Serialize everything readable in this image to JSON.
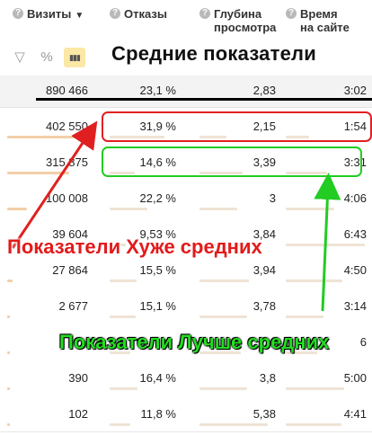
{
  "columns": {
    "visits": "Визиты",
    "visits_sort": "▼",
    "bounces": "Отказы",
    "depth_l1": "Глубина",
    "depth_l2": "просмотра",
    "time_l1": "Время",
    "time_l2": "на сайте"
  },
  "header_icon": "?",
  "tools": {
    "filter_icon": "▽",
    "percent_icon": "%",
    "chart_icon": "▮▮▮"
  },
  "annotations": {
    "average_title": "Средние показатели",
    "worse_label": "Показатели Хуже средних",
    "better_label": "Показатели Лучше средних"
  },
  "totals": {
    "visits": "890 466",
    "bounces": "23,1 %",
    "depth": "2,83",
    "time": "3:02"
  },
  "rows": [
    {
      "visits": "402 550",
      "bounces": "31,9 %",
      "depth": "2,15",
      "time": "1:54",
      "v_frac": 1.0,
      "b_frac": 0.78,
      "d_frac": 0.36,
      "t_frac": 0.3
    },
    {
      "visits": "315 875",
      "bounces": "14,6 %",
      "depth": "3,39",
      "time": "3:31",
      "v_frac": 0.78,
      "b_frac": 0.36,
      "d_frac": 0.57,
      "t_frac": 0.52
    },
    {
      "visits": "100 008",
      "bounces": "22,2 %",
      "depth": "3",
      "time": "4:06",
      "v_frac": 0.25,
      "b_frac": 0.54,
      "d_frac": 0.5,
      "t_frac": 0.61
    },
    {
      "visits": "39 604",
      "bounces": "9,53 %",
      "depth": "3,84",
      "time": "6:43",
      "v_frac": 0.1,
      "b_frac": 0.23,
      "d_frac": 0.64,
      "t_frac": 1.0
    },
    {
      "visits": "27 864",
      "bounces": "15,5 %",
      "depth": "3,94",
      "time": "4:50",
      "v_frac": 0.07,
      "b_frac": 0.38,
      "d_frac": 0.66,
      "t_frac": 0.72
    },
    {
      "visits": "2 677",
      "bounces": "15,1 %",
      "depth": "3,78",
      "time": "3:14",
      "v_frac": 0.01,
      "b_frac": 0.37,
      "d_frac": 0.63,
      "t_frac": 0.48
    },
    {
      "visits": "",
      "bounces": "",
      "depth": "",
      "time": "6",
      "v_frac": 0.01,
      "b_frac": 0.3,
      "d_frac": 0.55,
      "t_frac": 0.4
    },
    {
      "visits": "390",
      "bounces": "16,4 %",
      "depth": "3,8",
      "time": "5:00",
      "v_frac": 0.01,
      "b_frac": 0.4,
      "d_frac": 0.63,
      "t_frac": 0.74
    },
    {
      "visits": "102",
      "bounces": "11,8 %",
      "depth": "5,38",
      "time": "4:41",
      "v_frac": 0.005,
      "b_frac": 0.29,
      "d_frac": 0.9,
      "t_frac": 0.7
    }
  ]
}
